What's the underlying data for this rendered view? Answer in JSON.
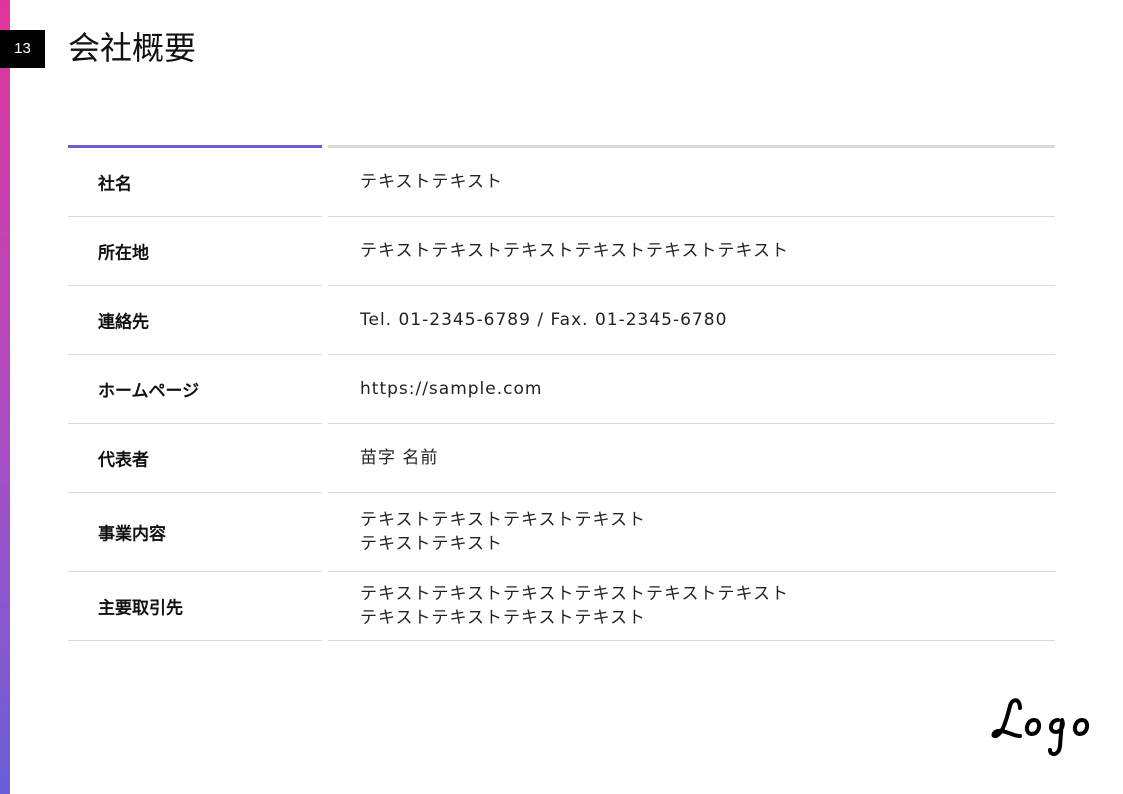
{
  "page_number": "13",
  "title": "会社概要",
  "colors": {
    "accent_gradient_top": "#e0339b",
    "accent_gradient_bottom": "#6a5fd8",
    "header_rule_accent": "#6b5fd0",
    "rule_gray": "#d9d9d9"
  },
  "rows": [
    {
      "label": "社名",
      "lines": [
        "テキストテキスト"
      ]
    },
    {
      "label": "所在地",
      "lines": [
        "テキストテキストテキストテキストテキストテキスト"
      ]
    },
    {
      "label": "連絡先",
      "lines": [
        "Tel. 01-2345-6789 / Fax. 01-2345-6780"
      ]
    },
    {
      "label": "ホームページ",
      "lines": [
        "https://sample.com"
      ]
    },
    {
      "label": "代表者",
      "lines": [
        "苗字 名前"
      ]
    },
    {
      "label": "事業内容",
      "lines": [
        "テキストテキストテキストテキスト",
        "テキストテキスト"
      ]
    },
    {
      "label": "主要取引先",
      "lines": [
        "テキストテキストテキストテキストテキストテキスト",
        "テキストテキストテキストテキスト"
      ]
    }
  ],
  "logo": {
    "text": "Logo",
    "icon": "logo-wordmark"
  }
}
